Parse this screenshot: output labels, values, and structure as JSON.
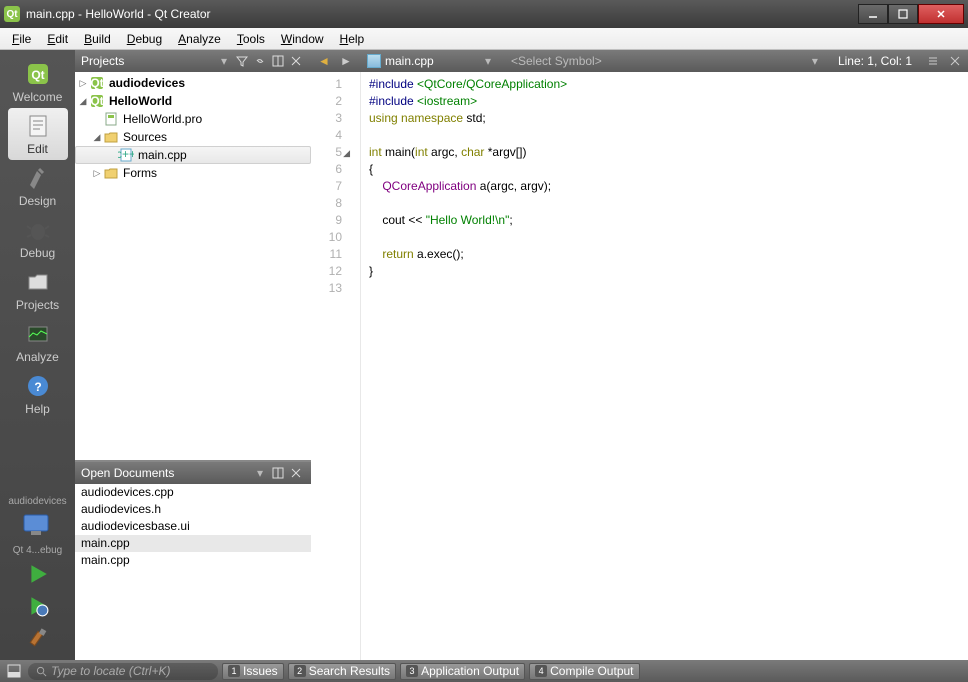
{
  "window_title": "main.cpp - HelloWorld - Qt Creator",
  "menu": [
    "File",
    "Edit",
    "Build",
    "Debug",
    "Analyze",
    "Tools",
    "Window",
    "Help"
  ],
  "modes": [
    {
      "id": "welcome",
      "label": "Welcome"
    },
    {
      "id": "edit",
      "label": "Edit"
    },
    {
      "id": "design",
      "label": "Design"
    },
    {
      "id": "debug",
      "label": "Debug"
    },
    {
      "id": "projects",
      "label": "Projects"
    },
    {
      "id": "analyze",
      "label": "Analyze"
    },
    {
      "id": "help",
      "label": "Help"
    }
  ],
  "active_mode": "edit",
  "kit_project": "audiodevices",
  "kit_config": "Qt 4...ebug",
  "projects_panel": {
    "title": "Projects",
    "tree": [
      {
        "indent": 0,
        "arrow": "▷",
        "icon": "project",
        "label": "audiodevices",
        "bold": true
      },
      {
        "indent": 0,
        "arrow": "◢",
        "icon": "project",
        "label": "HelloWorld",
        "bold": true
      },
      {
        "indent": 1,
        "arrow": "",
        "icon": "pro",
        "label": "HelloWorld.pro"
      },
      {
        "indent": 1,
        "arrow": "◢",
        "icon": "folder",
        "label": "Sources"
      },
      {
        "indent": 2,
        "arrow": "",
        "icon": "cpp",
        "label": "main.cpp",
        "selected": true
      },
      {
        "indent": 1,
        "arrow": "▷",
        "icon": "folder",
        "label": "Forms"
      }
    ]
  },
  "open_docs": {
    "title": "Open Documents",
    "items": [
      "audiodevices.cpp",
      "audiodevices.h",
      "audiodevicesbase.ui",
      "main.cpp",
      "main.cpp"
    ],
    "selected_index": 3
  },
  "editor": {
    "filename": "main.cpp",
    "symbol_placeholder": "<Select Symbol>",
    "position": "Line: 1, Col: 1",
    "lines": [
      {
        "n": 1,
        "html": "<span class='pp'>#include</span> <span class='inc'>&lt;QtCore/QCoreApplication&gt;</span>"
      },
      {
        "n": 2,
        "html": "<span class='pp'>#include</span> <span class='inc'>&lt;iostream&gt;</span>"
      },
      {
        "n": 3,
        "html": "<span class='kw'>using</span> <span class='kw'>namespace</span> std;"
      },
      {
        "n": 4,
        "html": ""
      },
      {
        "n": 5,
        "mark": "◢",
        "html": "<span class='kw'>int</span> main(<span class='kw'>int</span> argc, <span class='kw'>char</span> *argv[])"
      },
      {
        "n": 6,
        "html": "{"
      },
      {
        "n": 7,
        "html": "    <span class='type'>QCoreApplication</span> a(argc, argv);"
      },
      {
        "n": 8,
        "html": ""
      },
      {
        "n": 9,
        "html": "    cout &lt;&lt; <span class='str'>\"Hello World!\\n\"</span>;"
      },
      {
        "n": 10,
        "html": ""
      },
      {
        "n": 11,
        "html": "    <span class='kw'>return</span> a.exec();"
      },
      {
        "n": 12,
        "html": "}"
      },
      {
        "n": 13,
        "html": ""
      }
    ]
  },
  "locator_placeholder": "Type to locate (Ctrl+K)",
  "output_panes": [
    {
      "num": "1",
      "label": "Issues"
    },
    {
      "num": "2",
      "label": "Search Results"
    },
    {
      "num": "3",
      "label": "Application Output"
    },
    {
      "num": "4",
      "label": "Compile Output"
    }
  ]
}
